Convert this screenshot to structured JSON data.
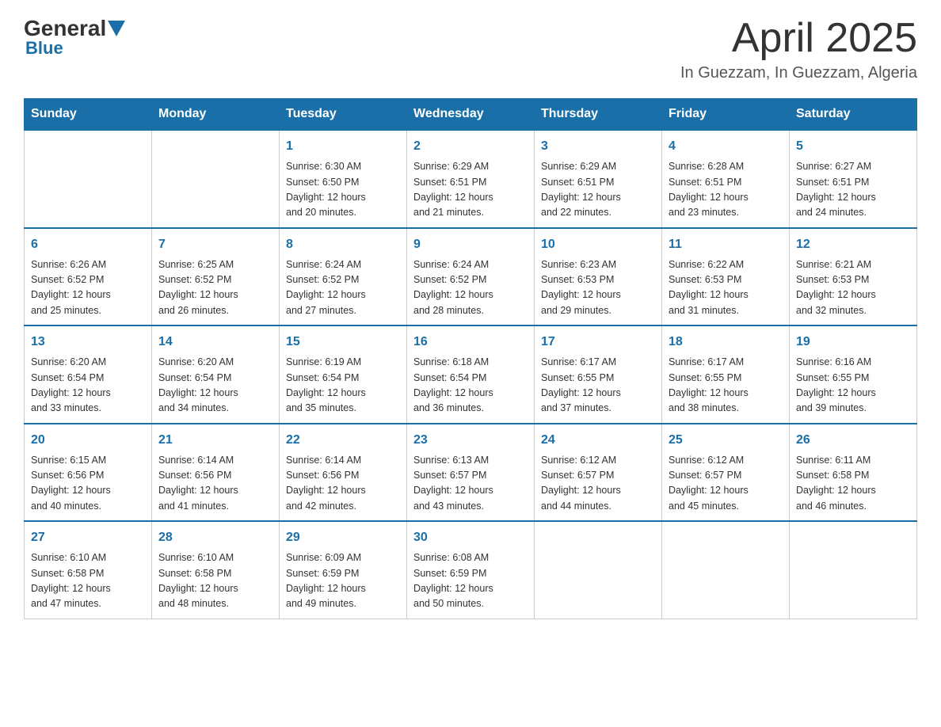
{
  "logo": {
    "general": "General",
    "blue": "Blue",
    "subtitle": "Blue"
  },
  "header": {
    "title": "April 2025",
    "location": "In Guezzam, In Guezzam, Algeria"
  },
  "days_of_week": [
    "Sunday",
    "Monday",
    "Tuesday",
    "Wednesday",
    "Thursday",
    "Friday",
    "Saturday"
  ],
  "weeks": [
    [
      {
        "day": "",
        "info": ""
      },
      {
        "day": "",
        "info": ""
      },
      {
        "day": "1",
        "info": "Sunrise: 6:30 AM\nSunset: 6:50 PM\nDaylight: 12 hours\nand 20 minutes."
      },
      {
        "day": "2",
        "info": "Sunrise: 6:29 AM\nSunset: 6:51 PM\nDaylight: 12 hours\nand 21 minutes."
      },
      {
        "day": "3",
        "info": "Sunrise: 6:29 AM\nSunset: 6:51 PM\nDaylight: 12 hours\nand 22 minutes."
      },
      {
        "day": "4",
        "info": "Sunrise: 6:28 AM\nSunset: 6:51 PM\nDaylight: 12 hours\nand 23 minutes."
      },
      {
        "day": "5",
        "info": "Sunrise: 6:27 AM\nSunset: 6:51 PM\nDaylight: 12 hours\nand 24 minutes."
      }
    ],
    [
      {
        "day": "6",
        "info": "Sunrise: 6:26 AM\nSunset: 6:52 PM\nDaylight: 12 hours\nand 25 minutes."
      },
      {
        "day": "7",
        "info": "Sunrise: 6:25 AM\nSunset: 6:52 PM\nDaylight: 12 hours\nand 26 minutes."
      },
      {
        "day": "8",
        "info": "Sunrise: 6:24 AM\nSunset: 6:52 PM\nDaylight: 12 hours\nand 27 minutes."
      },
      {
        "day": "9",
        "info": "Sunrise: 6:24 AM\nSunset: 6:52 PM\nDaylight: 12 hours\nand 28 minutes."
      },
      {
        "day": "10",
        "info": "Sunrise: 6:23 AM\nSunset: 6:53 PM\nDaylight: 12 hours\nand 29 minutes."
      },
      {
        "day": "11",
        "info": "Sunrise: 6:22 AM\nSunset: 6:53 PM\nDaylight: 12 hours\nand 31 minutes."
      },
      {
        "day": "12",
        "info": "Sunrise: 6:21 AM\nSunset: 6:53 PM\nDaylight: 12 hours\nand 32 minutes."
      }
    ],
    [
      {
        "day": "13",
        "info": "Sunrise: 6:20 AM\nSunset: 6:54 PM\nDaylight: 12 hours\nand 33 minutes."
      },
      {
        "day": "14",
        "info": "Sunrise: 6:20 AM\nSunset: 6:54 PM\nDaylight: 12 hours\nand 34 minutes."
      },
      {
        "day": "15",
        "info": "Sunrise: 6:19 AM\nSunset: 6:54 PM\nDaylight: 12 hours\nand 35 minutes."
      },
      {
        "day": "16",
        "info": "Sunrise: 6:18 AM\nSunset: 6:54 PM\nDaylight: 12 hours\nand 36 minutes."
      },
      {
        "day": "17",
        "info": "Sunrise: 6:17 AM\nSunset: 6:55 PM\nDaylight: 12 hours\nand 37 minutes."
      },
      {
        "day": "18",
        "info": "Sunrise: 6:17 AM\nSunset: 6:55 PM\nDaylight: 12 hours\nand 38 minutes."
      },
      {
        "day": "19",
        "info": "Sunrise: 6:16 AM\nSunset: 6:55 PM\nDaylight: 12 hours\nand 39 minutes."
      }
    ],
    [
      {
        "day": "20",
        "info": "Sunrise: 6:15 AM\nSunset: 6:56 PM\nDaylight: 12 hours\nand 40 minutes."
      },
      {
        "day": "21",
        "info": "Sunrise: 6:14 AM\nSunset: 6:56 PM\nDaylight: 12 hours\nand 41 minutes."
      },
      {
        "day": "22",
        "info": "Sunrise: 6:14 AM\nSunset: 6:56 PM\nDaylight: 12 hours\nand 42 minutes."
      },
      {
        "day": "23",
        "info": "Sunrise: 6:13 AM\nSunset: 6:57 PM\nDaylight: 12 hours\nand 43 minutes."
      },
      {
        "day": "24",
        "info": "Sunrise: 6:12 AM\nSunset: 6:57 PM\nDaylight: 12 hours\nand 44 minutes."
      },
      {
        "day": "25",
        "info": "Sunrise: 6:12 AM\nSunset: 6:57 PM\nDaylight: 12 hours\nand 45 minutes."
      },
      {
        "day": "26",
        "info": "Sunrise: 6:11 AM\nSunset: 6:58 PM\nDaylight: 12 hours\nand 46 minutes."
      }
    ],
    [
      {
        "day": "27",
        "info": "Sunrise: 6:10 AM\nSunset: 6:58 PM\nDaylight: 12 hours\nand 47 minutes."
      },
      {
        "day": "28",
        "info": "Sunrise: 6:10 AM\nSunset: 6:58 PM\nDaylight: 12 hours\nand 48 minutes."
      },
      {
        "day": "29",
        "info": "Sunrise: 6:09 AM\nSunset: 6:59 PM\nDaylight: 12 hours\nand 49 minutes."
      },
      {
        "day": "30",
        "info": "Sunrise: 6:08 AM\nSunset: 6:59 PM\nDaylight: 12 hours\nand 50 minutes."
      },
      {
        "day": "",
        "info": ""
      },
      {
        "day": "",
        "info": ""
      },
      {
        "day": "",
        "info": ""
      }
    ]
  ]
}
